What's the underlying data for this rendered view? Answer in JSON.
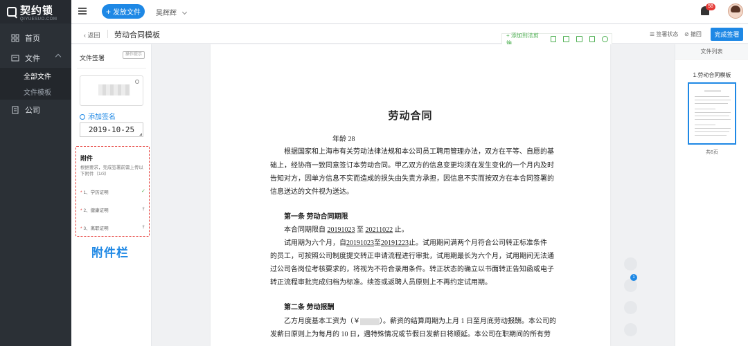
{
  "brand": {
    "logo": "契约锁",
    "sub": "QIYUESUO.COM"
  },
  "sidebar": {
    "items": [
      {
        "label": "首页"
      },
      {
        "label": "文件",
        "subitems": [
          {
            "label": "全部文件"
          },
          {
            "label": "文件模板"
          }
        ]
      },
      {
        "label": "公司"
      }
    ]
  },
  "topbar": {
    "send_label": "发放文件",
    "user_label": "吴辉辉",
    "notification_count": "58"
  },
  "subheader": {
    "back_label": "返回",
    "title": "劳动合同模板",
    "toolbar_add": "添加到法剪箱",
    "sign_status": "签署状态",
    "withdraw": "撤回",
    "finish_label": "完成签署"
  },
  "left_panel": {
    "title": "文件签署",
    "tip": "操作提示",
    "add_signature": "添加签名",
    "date": "2019-10-25",
    "attachments": {
      "title": "附件",
      "desc": "根据要求，完成签署前需上传以下附件（1/3）",
      "items": [
        {
          "label": "1、学历证明",
          "state": "done"
        },
        {
          "label": "2、健康证明",
          "state": "upload"
        },
        {
          "label": "3、离职证明",
          "state": "upload"
        }
      ]
    },
    "callout": "附件栏"
  },
  "document": {
    "title": "劳动合同",
    "age_line": "年龄 28",
    "intro1": "根据国家和上海市有关劳动法律法规和本公司员工聘用管理办法，双方在平等、自愿的基",
    "intro2": "础上，经协商一致同意签订本劳动合同。甲乙双方的信息变更均须在发生变化的一个月内及时",
    "intro3": "告知对方，因单方信息不实而造成的损失由失责方承担，因信息不实而按双方在本合同签署的",
    "intro4": "信息送达的文件视为送达。",
    "s1_title": "第一条  劳动合同期限",
    "s1_p1_a": "本合同期限自",
    "s1_p1_start": "20191023",
    "s1_p1_b": "至",
    "s1_p1_end": "20211022",
    "s1_p1_c": "止。",
    "s1_p2_a": "试用期为六个月，自",
    "s1_p2_start": "20191023",
    "s1_p2_b": "至",
    "s1_p2_end": "20191223",
    "s1_p2_c": "止。试用期间满两个月符合公司转正标准条件",
    "s1_p3": "的员工，可按照公司制度提交转正申请流程进行审批，试用期最长为六个月，试用期间无法通",
    "s1_p4": "过公司各岗位考核要求的，将视为不符合录用条件。转正状态的确立以书面转正告知函或电子",
    "s1_p5": "转正流程审批完成归档为标准。续签或返聘人员原则上不再约定试用期。",
    "s2_title": "第二条  劳动报酬",
    "s2_p1_a": "乙方月度基本工资为（",
    "s2_p1_yen": "￥",
    "s2_p1_b": "）。薪资的结算周期为上月 1 日至月底劳动报酬。本公司的",
    "s2_p2": "发薪日原则上为每月的 10 日，遇特殊情况或节假日发薪日将顺延。本公司在职期间的所有劳"
  },
  "right_panel": {
    "title": "文件列表",
    "doc_name": "1.劳动合同模板",
    "pages": "共6页"
  },
  "floating_badge": "1",
  "colors": {
    "accent": "#1e88e5",
    "nav_bg": "#2b3036",
    "callout": "#1e88e5",
    "dashed": "#e53935",
    "ok": "#4caf50"
  }
}
